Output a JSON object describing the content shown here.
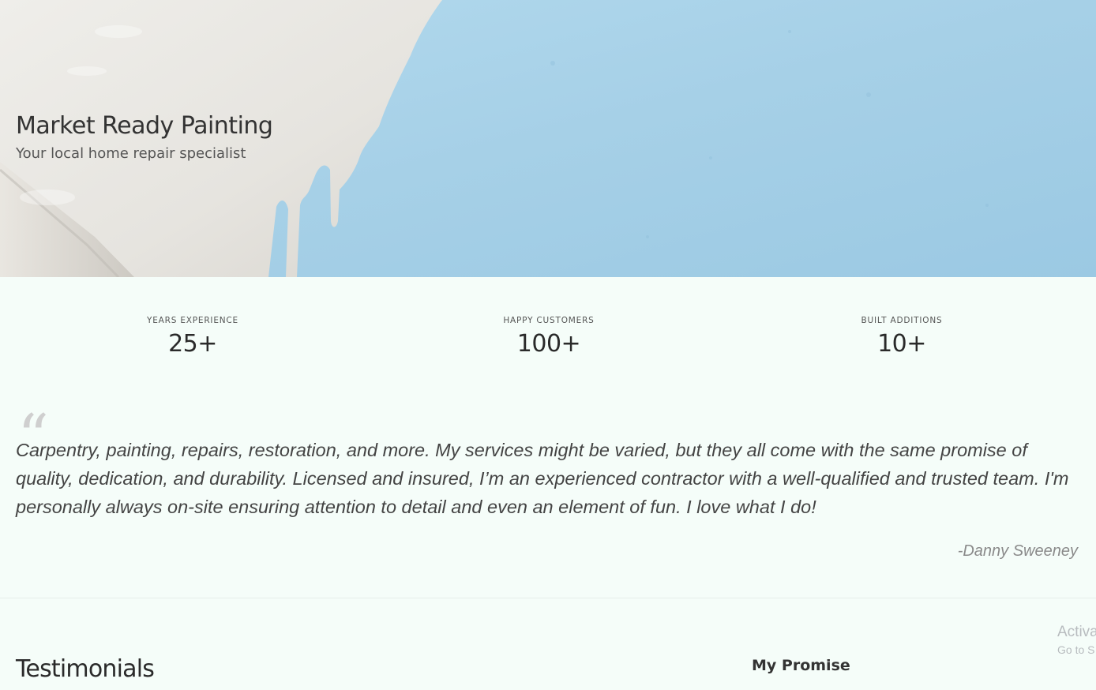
{
  "hero": {
    "title": "Market Ready Painting",
    "subtitle": "Your local home repair specialist",
    "colors": {
      "wall_blue": "#a9d3ea",
      "paint_white": "#e8e6e1"
    }
  },
  "stats": [
    {
      "label": "YEARS EXPERIENCE",
      "value": "25+"
    },
    {
      "label": "HAPPY CUSTOMERS",
      "value": "100+"
    },
    {
      "label": "BUILT ADDITIONS",
      "value": "10+"
    }
  ],
  "quote": {
    "text": "Carpentry, painting, repairs, restoration, and more. My services might be varied, but they all come with the same promise of quality, dedication, and durability. Licensed and insured, I’m an experienced contractor with a well-qualified and trusted team. I'm personally always on-site ensuring attention to detail and even an element of fun. I love what I do!",
    "author": "-Danny Sweeney",
    "mark": "“"
  },
  "sections": {
    "testimonials_title": "Testimonials",
    "promise_title": "My Promise"
  },
  "watermark": {
    "line1": "Activa",
    "line2": "Go to S"
  }
}
